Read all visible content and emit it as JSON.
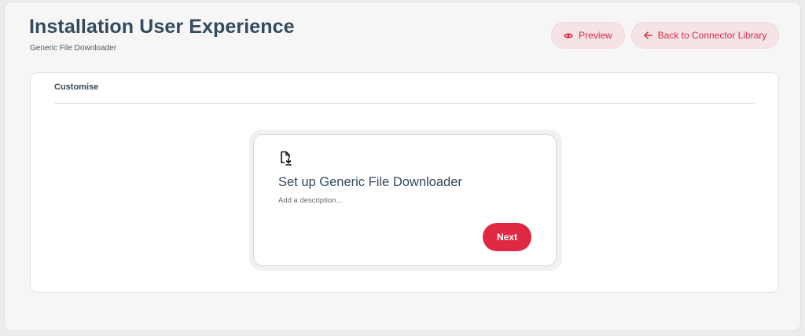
{
  "header": {
    "title": "Installation User Experience",
    "subtitle": "Generic File Downloader",
    "preview_label": "Preview",
    "preview_icon": "eye-icon",
    "back_label": "Back to Connector Library",
    "back_icon": "arrow-left-icon"
  },
  "panel": {
    "tab_label": "Customise"
  },
  "card": {
    "icon": "file-download-icon",
    "title": "Set up Generic File Downloader",
    "description": "Add a description...",
    "next_label": "Next"
  },
  "colors": {
    "accent": "#df2841",
    "soft_button_bg": "#f6e3e5",
    "title_text": "#34495e"
  }
}
